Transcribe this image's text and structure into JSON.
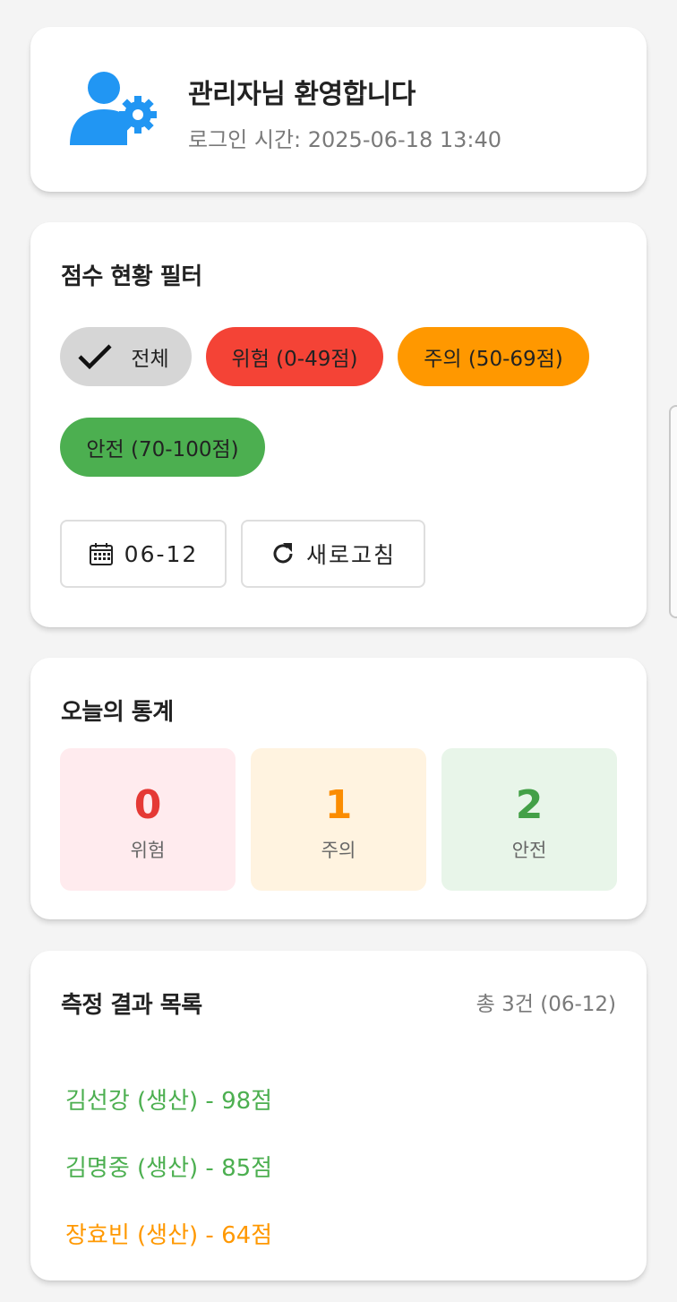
{
  "header": {
    "welcome": "관리자님 환영합니다",
    "login_time": "로그인 시간: 2025-06-18 13:40"
  },
  "filter": {
    "title": "점수 현황 필터",
    "chips": [
      {
        "label": "전체",
        "selected": true,
        "color": "#d6d6d6"
      },
      {
        "label": "위험 (0-49점)",
        "selected": false,
        "color": "#f44336"
      },
      {
        "label": "주의 (50-69점)",
        "selected": false,
        "color": "#ff9800"
      },
      {
        "label": "안전 (70-100점)",
        "selected": false,
        "color": "#4caf50"
      }
    ],
    "date_label": "06-12",
    "refresh_label": "새로고침"
  },
  "stats": {
    "title": "오늘의 통계",
    "items": [
      {
        "value": "0",
        "label": "위험",
        "color": "#e53935"
      },
      {
        "value": "1",
        "label": "주의",
        "color": "#fb8c00"
      },
      {
        "value": "2",
        "label": "안전",
        "color": "#43a047"
      }
    ]
  },
  "results": {
    "title": "측정 결과 목록",
    "count": "총 3건 (06-12)",
    "items": [
      {
        "text": "김선강 (생산) - 98점",
        "status": "safe"
      },
      {
        "text": "김명중 (생산) - 85점",
        "status": "safe"
      },
      {
        "text": "장효빈 (생산) - 64점",
        "status": "caution"
      }
    ]
  }
}
